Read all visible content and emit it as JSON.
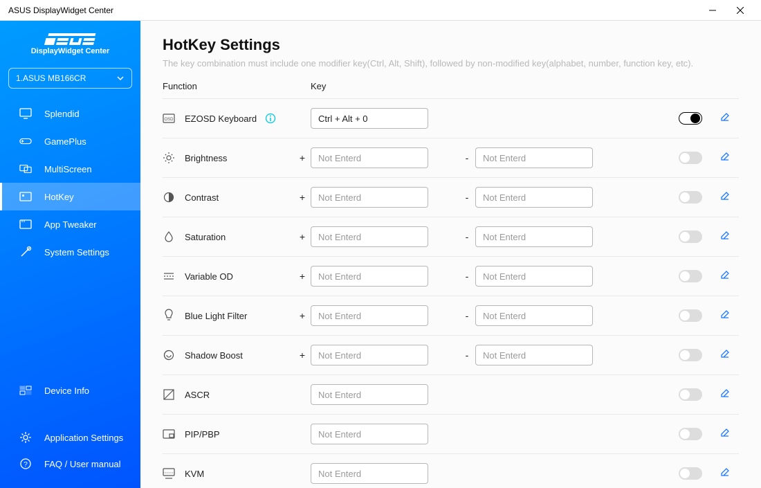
{
  "window": {
    "title": "ASUS DisplayWidget Center"
  },
  "sidebar": {
    "brand": "ASUS",
    "brand_sub": "DisplayWidget Center",
    "device_selected": "1.ASUS MB166CR",
    "nav": [
      {
        "label": "Splendid",
        "icon": "monitor-icon"
      },
      {
        "label": "GamePlus",
        "icon": "gamepad-icon"
      },
      {
        "label": "MultiScreen",
        "icon": "multiscreen-icon"
      },
      {
        "label": "HotKey",
        "icon": "hotkey-icon",
        "active": true
      },
      {
        "label": "App Tweaker",
        "icon": "apptweaker-icon"
      },
      {
        "label": "System Settings",
        "icon": "tools-icon"
      }
    ],
    "device_info": "Device Info",
    "app_settings": "Application Settings",
    "faq": "FAQ / User manual"
  },
  "page": {
    "title": "HotKey Settings",
    "subtitle": "The key combination must include one modifier key(Ctrl, Alt, Shift), followed by non-modified key(alphabet, number, function key, etc).",
    "col_function": "Function",
    "col_key": "Key"
  },
  "rows": [
    {
      "name": "EZOSD Keyboard",
      "icon": "osd-icon",
      "info": true,
      "single_key": "Ctrl + Alt + 0",
      "toggled": true
    },
    {
      "name": "Brightness",
      "icon": "brightness-icon",
      "plus_minus": true,
      "placeholder": "Not Enterd",
      "toggled": false
    },
    {
      "name": "Contrast",
      "icon": "contrast-icon",
      "plus_minus": true,
      "placeholder": "Not Enterd",
      "toggled": false
    },
    {
      "name": "Saturation",
      "icon": "saturation-icon",
      "plus_minus": true,
      "placeholder": "Not Enterd",
      "toggled": false
    },
    {
      "name": "Variable OD",
      "icon": "variableod-icon",
      "plus_minus": true,
      "placeholder": "Not Enterd",
      "toggled": false
    },
    {
      "name": "Blue Light Filter",
      "icon": "bluelight-icon",
      "plus_minus": true,
      "placeholder": "Not Enterd",
      "toggled": false
    },
    {
      "name": "Shadow Boost",
      "icon": "shadowboost-icon",
      "plus_minus": true,
      "placeholder": "Not Enterd",
      "toggled": false
    },
    {
      "name": "ASCR",
      "icon": "ascr-icon",
      "single": true,
      "placeholder": "Not Enterd",
      "toggled": false
    },
    {
      "name": "PIP/PBP",
      "icon": "pippbp-icon",
      "single": true,
      "placeholder": "Not Enterd",
      "toggled": false
    },
    {
      "name": "KVM",
      "icon": "kvm-icon",
      "single": true,
      "placeholder": "Not Enterd",
      "toggled": false
    }
  ],
  "signs": {
    "plus": "+",
    "minus": "-"
  }
}
